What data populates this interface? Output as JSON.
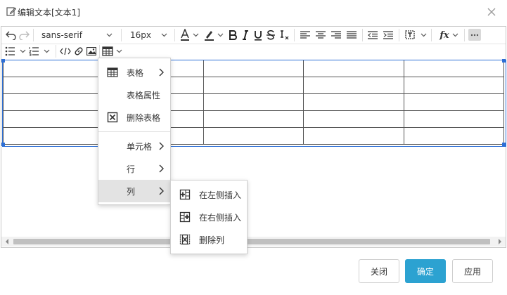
{
  "dialog": {
    "title": "编辑文本[文本1]"
  },
  "toolbar": {
    "font_family": "sans-serif",
    "font_size": "16px",
    "fx_label": "fx"
  },
  "table_menu": {
    "items": [
      {
        "label": "表格",
        "icon": "table-icon",
        "has_submenu": true
      },
      {
        "label": "表格属性",
        "icon": "",
        "has_submenu": false
      },
      {
        "label": "删除表格",
        "icon": "delete-table-icon",
        "has_submenu": false
      },
      {
        "label": "单元格",
        "icon": "",
        "has_submenu": true
      },
      {
        "label": "行",
        "icon": "",
        "has_submenu": true
      },
      {
        "label": "列",
        "icon": "",
        "has_submenu": true,
        "highlighted": true
      }
    ]
  },
  "column_submenu": {
    "items": [
      {
        "label": "在左侧插入",
        "icon": "insert-column-left-icon"
      },
      {
        "label": "在右侧插入",
        "icon": "insert-column-right-icon"
      },
      {
        "label": "删除列",
        "icon": "delete-column-icon"
      }
    ]
  },
  "footer": {
    "close_label": "关闭",
    "ok_label": "确定",
    "apply_label": "应用"
  },
  "colors": {
    "accent": "#2ca2d1",
    "selection": "#2d6fd6",
    "menu_highlight": "#e3e3e3"
  }
}
